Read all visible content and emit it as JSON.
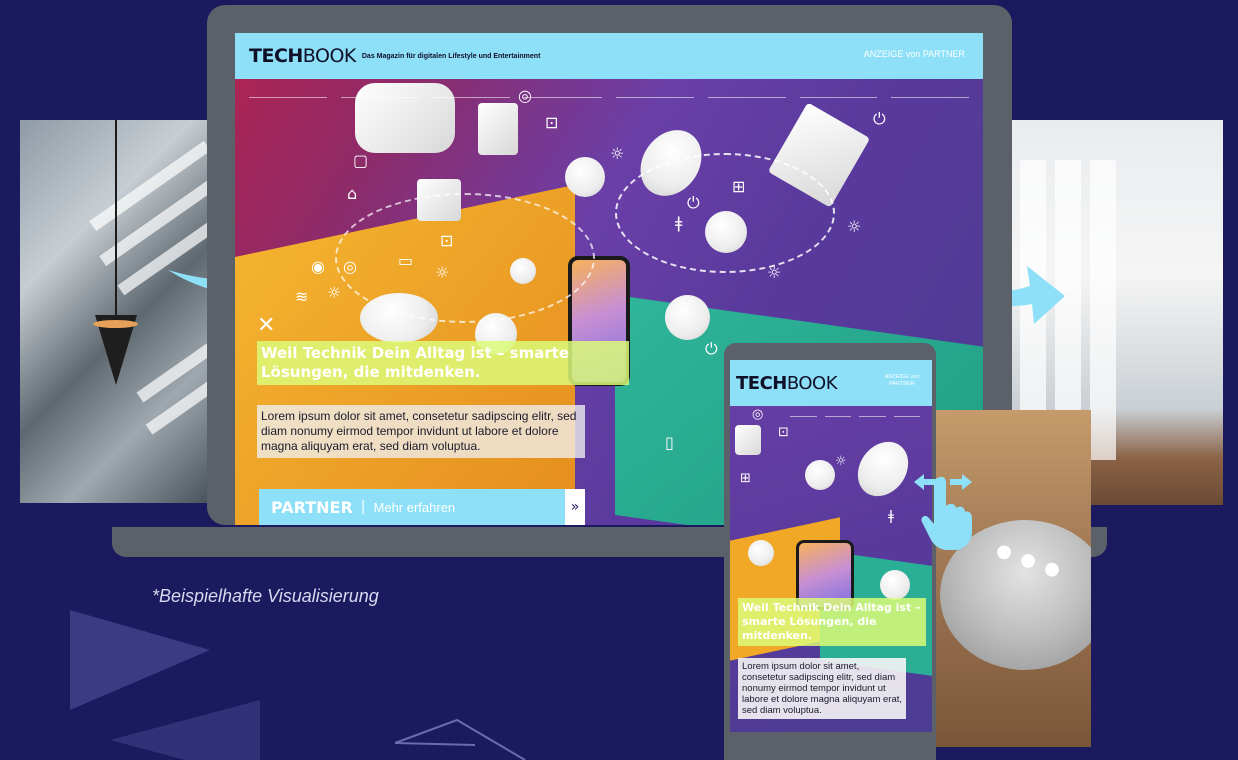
{
  "laptop_screen": {
    "logo_bold": "TECH",
    "logo_light": "BOOK",
    "tagline": "Das Magazin für digitalen Lifestyle und Entertainment",
    "ad_label": "ANZEIGE von PARTNER",
    "headline": "Weil Technik Dein Alltag ist – smarte Lösungen, die mitdenken.",
    "body": "Lorem ipsum dolor sit amet, consetetur sadipscing elitr, sed diam nonumy eirmod tempor invidunt ut labore et dolore magna aliquyam erat, sed diam voluptua.",
    "cta": {
      "partner": "PARTNER",
      "separator": "|",
      "label": "Mehr erfahren",
      "arrow_icon": "»"
    }
  },
  "phone_screen": {
    "logo_bold": "TECH",
    "logo_light": "BOOK",
    "ad_label": "ANZEIGE von PARTNER",
    "headline": "Weil Technik Dein Alltag ist – smarte Lösungen, die mitdenken.",
    "body": "Lorem ipsum dolor sit amet, consetetur sadipscing elitr, sed diam nonumy eirmod tempor invidunt ut labore et dolore magna aliquyam erat, sed diam voluptua."
  },
  "caption": "*Beispielhafte Visualisierung",
  "colors": {
    "background": "#1b1a5e",
    "accent": "#8de0f8",
    "headline_bg": "#dcfa78",
    "device": "#5c6068"
  },
  "icons": [
    "arrow-right-icon",
    "swipe-hand-icon",
    "lightbulb-icon",
    "power-icon",
    "wifi-icon",
    "plug-icon",
    "camera-icon",
    "monitor-icon",
    "thermometer-icon"
  ]
}
